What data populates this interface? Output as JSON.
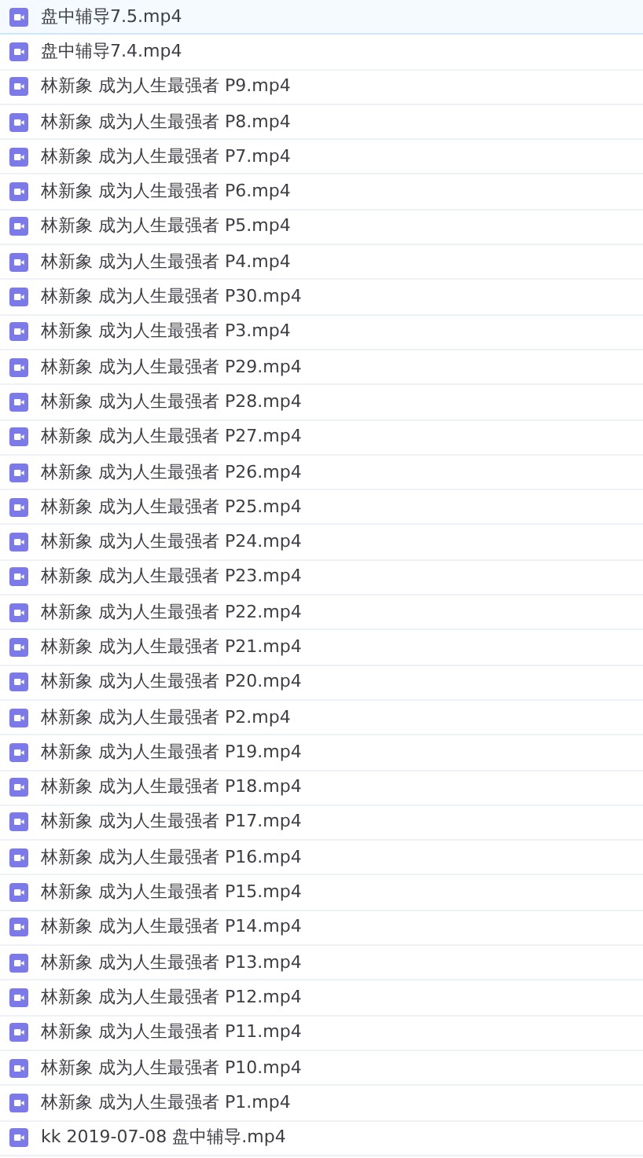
{
  "files": [
    {
      "name": "盘中辅导7.5.mp4",
      "selected": true
    },
    {
      "name": "盘中辅导7.4.mp4",
      "selected": false
    },
    {
      "name": "林新象 成为人生最强者 P9.mp4",
      "selected": false
    },
    {
      "name": "林新象 成为人生最强者 P8.mp4",
      "selected": false
    },
    {
      "name": "林新象 成为人生最强者 P7.mp4",
      "selected": false
    },
    {
      "name": "林新象 成为人生最强者 P6.mp4",
      "selected": false
    },
    {
      "name": "林新象 成为人生最强者 P5.mp4",
      "selected": false
    },
    {
      "name": "林新象 成为人生最强者 P4.mp4",
      "selected": false
    },
    {
      "name": "林新象 成为人生最强者 P30.mp4",
      "selected": false
    },
    {
      "name": "林新象 成为人生最强者 P3.mp4",
      "selected": false
    },
    {
      "name": "林新象 成为人生最强者 P29.mp4",
      "selected": false
    },
    {
      "name": "林新象 成为人生最强者 P28.mp4",
      "selected": false
    },
    {
      "name": "林新象 成为人生最强者 P27.mp4",
      "selected": false
    },
    {
      "name": "林新象 成为人生最强者 P26.mp4",
      "selected": false
    },
    {
      "name": "林新象 成为人生最强者 P25.mp4",
      "selected": false
    },
    {
      "name": "林新象 成为人生最强者 P24.mp4",
      "selected": false
    },
    {
      "name": "林新象 成为人生最强者 P23.mp4",
      "selected": false
    },
    {
      "name": "林新象 成为人生最强者 P22.mp4",
      "selected": false
    },
    {
      "name": "林新象 成为人生最强者 P21.mp4",
      "selected": false
    },
    {
      "name": "林新象 成为人生最强者 P20.mp4",
      "selected": false
    },
    {
      "name": "林新象 成为人生最强者 P2.mp4",
      "selected": false
    },
    {
      "name": "林新象 成为人生最强者 P19.mp4",
      "selected": false
    },
    {
      "name": "林新象 成为人生最强者 P18.mp4",
      "selected": false
    },
    {
      "name": "林新象 成为人生最强者 P17.mp4",
      "selected": false
    },
    {
      "name": "林新象 成为人生最强者 P16.mp4",
      "selected": false
    },
    {
      "name": "林新象 成为人生最强者 P15.mp4",
      "selected": false
    },
    {
      "name": "林新象 成为人生最强者 P14.mp4",
      "selected": false
    },
    {
      "name": "林新象 成为人生最强者 P13.mp4",
      "selected": false
    },
    {
      "name": "林新象 成为人生最强者 P12.mp4",
      "selected": false
    },
    {
      "name": "林新象 成为人生最强者 P11.mp4",
      "selected": false
    },
    {
      "name": "林新象 成为人生最强者 P10.mp4",
      "selected": false
    },
    {
      "name": "林新象 成为人生最强者 P1.mp4",
      "selected": false
    },
    {
      "name": "kk 2019-07-08 盘中辅导.mp4",
      "selected": false
    }
  ]
}
